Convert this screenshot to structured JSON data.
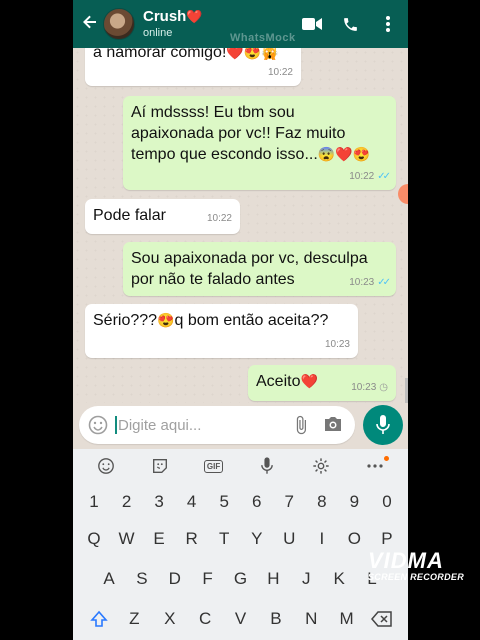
{
  "header": {
    "contact_name": "Crush",
    "contact_heart": "❤️",
    "status": "online",
    "watermark": "WhatsMock"
  },
  "messages": [
    {
      "dir": "in",
      "text": "a namorar comigo!",
      "emoji": "❤️😍🙀",
      "time": "10:22"
    },
    {
      "dir": "out",
      "lines": [
        "Aí mdssss! Eu tbm sou",
        "apaixonada por vc!! Faz muito",
        "tempo que escondo isso..."
      ],
      "emoji": "😨❤️😍",
      "time": "10:22",
      "read": true
    },
    {
      "dir": "in",
      "text": "Pode falar",
      "time": "10:22"
    },
    {
      "dir": "out",
      "lines": [
        "Sou apaixonada por vc, desculpa",
        "por não te falado antes"
      ],
      "time": "10:23",
      "read": true
    },
    {
      "dir": "in",
      "text": "Sério???",
      "emoji": "😍",
      "text2": "q bom então aceita??",
      "time": "10:23"
    },
    {
      "dir": "out",
      "text": "Aceito",
      "emoji": "❤️",
      "time": "10:23",
      "read": false
    }
  ],
  "input": {
    "placeholder": "Digite aqui..."
  },
  "keyboard": {
    "toolbar": [
      "emoji",
      "sticker",
      "gif",
      "voice",
      "settings",
      "more"
    ],
    "gif_label": "GIF",
    "numbers": [
      "1",
      "2",
      "3",
      "4",
      "5",
      "6",
      "7",
      "8",
      "9",
      "0"
    ],
    "row1": [
      "Q",
      "W",
      "E",
      "R",
      "T",
      "Y",
      "U",
      "I",
      "O",
      "P"
    ],
    "row2": [
      "A",
      "S",
      "D",
      "F",
      "G",
      "H",
      "J",
      "K",
      "L"
    ],
    "row3": [
      "Z",
      "X",
      "C",
      "V",
      "B",
      "N",
      "M"
    ]
  },
  "recorder": {
    "brand": "VIDMA",
    "subtitle": "SCREEN RECORDER"
  },
  "colors": {
    "header": "#075e54",
    "outgoing": "#dcf8c6",
    "incoming": "#ffffff",
    "accent": "#00897b",
    "read_tick": "#4fc3f7"
  }
}
